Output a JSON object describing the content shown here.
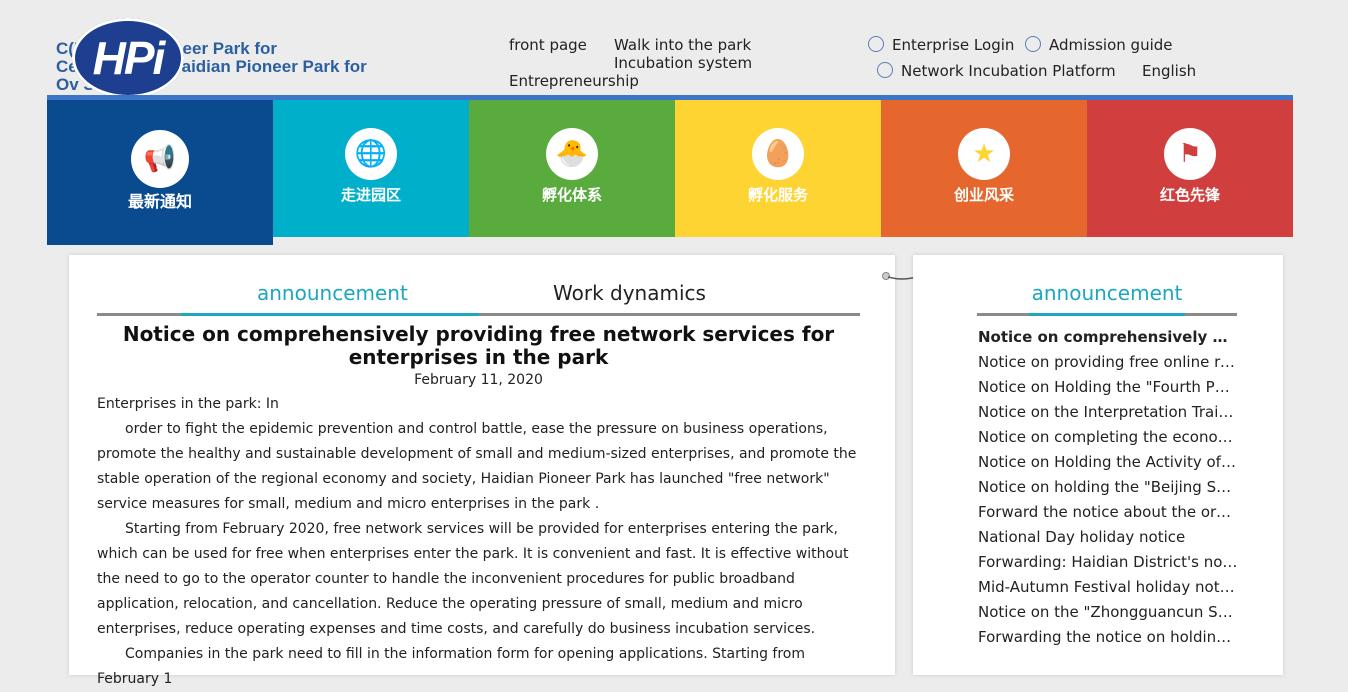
{
  "header": {
    "brand_lines": [
      "C(Haidian) Pioneer Park for",
      "Cents Beijing Haidian Pioneer Park for",
      "Ov Students"
    ],
    "logo_text": "HPi",
    "nav": {
      "front_page": "front page",
      "walk_into_park": "Walk into the park",
      "incubation_system": "Incubation system",
      "entrepreneurship": "Entrepreneurship"
    },
    "top_links": {
      "enterprise_login": "Enterprise Login",
      "admission_guide": "Admission guide",
      "network_incubation_platform": "Network Incubation Platform",
      "english": "English"
    }
  },
  "tiles": [
    {
      "label": "最新通知",
      "icon": "megaphone-icon",
      "color": "#0a4b8f"
    },
    {
      "label": "走进园区",
      "icon": "globe-icon",
      "color": "#00afca"
    },
    {
      "label": "孵化体系",
      "icon": "chick-icon",
      "color": "#5aab3e"
    },
    {
      "label": "孵化服务",
      "icon": "egg-icon",
      "color": "#fdd431"
    },
    {
      "label": "创业风采",
      "icon": "star-icon",
      "color": "#e5672e"
    },
    {
      "label": "红色先锋",
      "icon": "flag-icon",
      "color": "#d13e3e"
    }
  ],
  "main": {
    "tabs": [
      "announcement",
      "Work dynamics"
    ],
    "article": {
      "title": "Notice on comprehensively providing free network services for enterprises in the park",
      "date": "February 11, 2020",
      "paragraphs": [
        "Enterprises in the park: In",
        "order to fight the epidemic prevention and control battle, ease the pressure on business operations, promote the healthy and sustainable development of small and medium-sized enterprises, and promote the stable operation of the regional economy and society, Haidian Pioneer Park has launched \"free network\" service measures for small, medium and micro enterprises in the park .",
        "Starting from February 2020, free network services will be provided for enterprises entering the park, which can be used for free when enterprises enter the park. It is convenient and fast. It is effective without the need to go to the operator counter to handle the inconvenient procedures for public broadband application, relocation, and cancellation. Reduce the operating pressure of small, medium and micro enterprises, reduce operating expenses and time costs, and carefully do business incubation services.",
        "Companies in the park need to fill in the information form for opening applications. Starting from February 1"
      ]
    }
  },
  "side": {
    "tab": "announcement",
    "items": [
      "Notice on comprehensively provid...",
      "Notice on providing free online recr...",
      "Notice on Holding the \"Fourth Phase...",
      "Notice on the Interpretation Training...",
      "Notice on completing the economic ...",
      "Notice on Holding the Activity of  “...",
      "Notice on holding the \"Beijing Scien...",
      "Forward the notice about the organi...",
      "National Day holiday notice",
      "Forwarding: Haidian District's notice ...",
      "Mid-Autumn Festival holiday notice",
      "Notice on the \"Zhongguancun Scien...",
      "Forwarding the notice on holding th..."
    ]
  }
}
